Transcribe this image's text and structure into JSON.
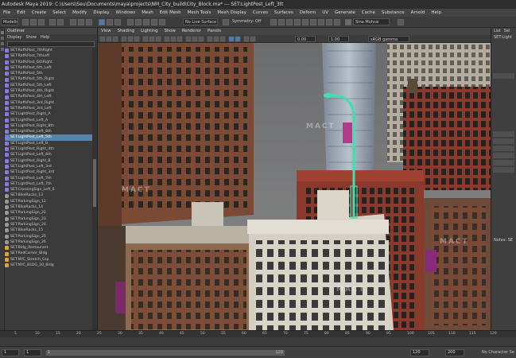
{
  "window": {
    "title": "Autodesk Maya 2019: C:\\Users\\Seu\\Documents\\maya\\projects\\NM_City_build\\City_Block.ma*  ---  SET:LightPost_Left_3tt"
  },
  "menubar": [
    "File",
    "Edit",
    "Create",
    "Select",
    "Modify",
    "Display",
    "Windows",
    "Mesh",
    "Edit Mesh",
    "Mesh Tools",
    "Mesh Display",
    "Curves",
    "Surfaces",
    "Deform",
    "UV",
    "Generate",
    "Cache",
    "Substance",
    "Arnold",
    "Help"
  ],
  "toolbar": {
    "mode": "Modeling",
    "live_surface": "No Live Surface",
    "symmetry": "Symmetry: Off",
    "user": "Sina Mohrai"
  },
  "outliner": {
    "title": "Outliner",
    "menu": [
      "Display",
      "Show",
      "Help"
    ],
    "items": [
      {
        "label": "SET:RaffsPost_7thRight",
        "kind": "set"
      },
      {
        "label": "SET:RaffsPost_7thLeft",
        "kind": "set"
      },
      {
        "label": "SET:RaffsPost_6thRight",
        "kind": "set"
      },
      {
        "label": "SET:RaffsPost_6th_Left",
        "kind": "set"
      },
      {
        "label": "SET:RaffsPost_5th",
        "kind": "set"
      },
      {
        "label": "SET:RaffsPost_5th_Right",
        "kind": "set"
      },
      {
        "label": "SET:RaffsPost_5th_Left",
        "kind": "set"
      },
      {
        "label": "SET:RaffsPost_4th_Right",
        "kind": "set"
      },
      {
        "label": "SET:RaffsPost_4th_Left",
        "kind": "set"
      },
      {
        "label": "SET:RaffsPost_3rd_Right",
        "kind": "set"
      },
      {
        "label": "SET:RaffsPost_3rd_Left",
        "kind": "set"
      },
      {
        "label": "SET:LightPost_Right_A",
        "kind": "set"
      },
      {
        "label": "SET:LightPost_Left_A",
        "kind": "set"
      },
      {
        "label": "SET:LightPost_Right_8th",
        "kind": "set"
      },
      {
        "label": "SET:LightPost_Left_8th",
        "kind": "set"
      },
      {
        "label": "SET:LightPost_Left_5th",
        "kind": "set",
        "selected": true
      },
      {
        "label": "SET:LightPost_Left_B",
        "kind": "set"
      },
      {
        "label": "SET:LightPost_Right_4th",
        "kind": "set"
      },
      {
        "label": "SET:LightPost_Left_4th",
        "kind": "set"
      },
      {
        "label": "SET:LightPost_Right_B",
        "kind": "set"
      },
      {
        "label": "SET:LightPost_Left_3rd",
        "kind": "set"
      },
      {
        "label": "SET:LightPost_Right_3rd",
        "kind": "set"
      },
      {
        "label": "SET:LightPost_Left_7th",
        "kind": "set"
      },
      {
        "label": "SET:LightPost_Left_7th",
        "kind": "set"
      },
      {
        "label": "SET:CrossingSign_Left_6",
        "kind": "set"
      },
      {
        "label": "SET:BikeRacks_13",
        "kind": "node"
      },
      {
        "label": "SET:ParkingSign_12",
        "kind": "node"
      },
      {
        "label": "SET:BikeRacks_14",
        "kind": "node"
      },
      {
        "label": "SET:ParkingSign_22",
        "kind": "node"
      },
      {
        "label": "SET:ParkingSign_23",
        "kind": "node"
      },
      {
        "label": "SET:ParkingSign_24",
        "kind": "node"
      },
      {
        "label": "SET:BikeRacks_15",
        "kind": "node"
      },
      {
        "label": "SET:ParkingSign_25",
        "kind": "node"
      },
      {
        "label": "SET:ParkingSign_26",
        "kind": "node"
      },
      {
        "label": "SET:Bldg_Restaurant",
        "kind": "grp"
      },
      {
        "label": "SET:RedCorner_Bldg",
        "kind": "grp"
      },
      {
        "label": "SET:NYC_Stretch_Grp",
        "kind": "grp"
      },
      {
        "label": "SET:NYC_BLDG_30_Bldg",
        "kind": "grp"
      }
    ]
  },
  "viewport": {
    "menu": [
      "View",
      "Shading",
      "Lighting",
      "Show",
      "Renderer",
      "Panels"
    ],
    "exposure": "0.00",
    "gamma": "1.00",
    "colorspace": "sRGB gamma"
  },
  "right_panel": {
    "tabs": [
      "List",
      "Sel"
    ],
    "object": "SET:Light",
    "notes_label": "Notes: SE"
  },
  "timeline": {
    "ticks": [
      "5",
      "10",
      "15",
      "20",
      "25",
      "30",
      "35",
      "40",
      "45",
      "50",
      "55",
      "60",
      "65",
      "70",
      "75",
      "80",
      "85",
      "90",
      "95",
      "100",
      "105",
      "110",
      "115",
      "120"
    ]
  },
  "range": {
    "start": "1",
    "current": "1",
    "range_start": "1",
    "range_end": "120",
    "end": "120",
    "max": "200",
    "character_set": "No Character Se"
  }
}
